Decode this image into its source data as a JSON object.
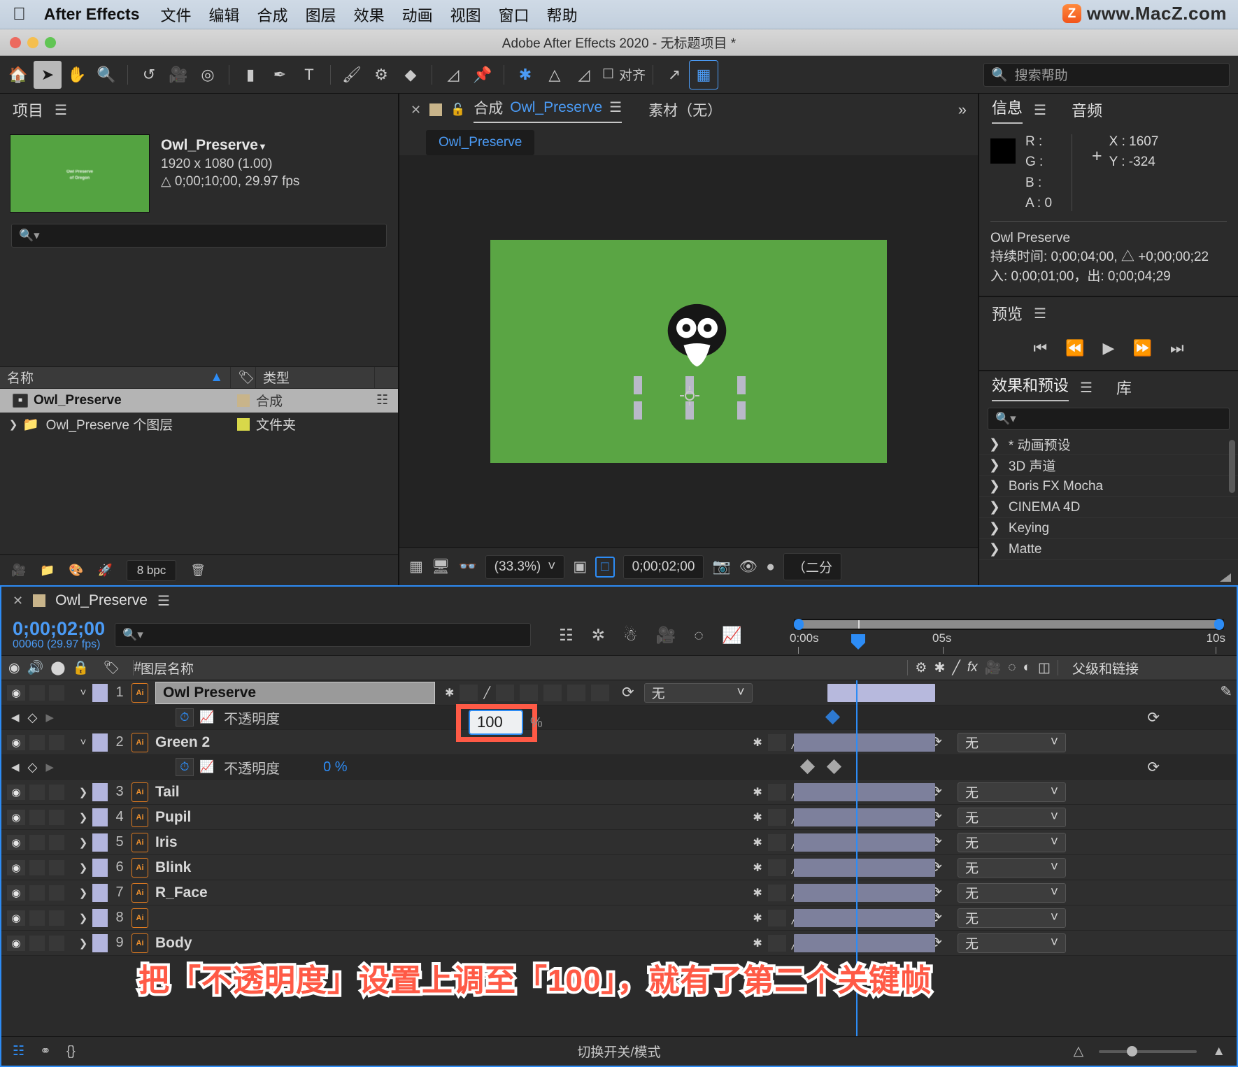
{
  "macmenu": {
    "apple": "apple-logo",
    "app": "After Effects",
    "items": [
      "文件",
      "编辑",
      "合成",
      "图层",
      "效果",
      "动画",
      "视图",
      "窗口",
      "帮助"
    ],
    "watermark_badge": "Z",
    "watermark_text": "www.MacZ.com"
  },
  "window": {
    "title": "Adobe After Effects 2020 - 无标题项目 *"
  },
  "toolbar": {
    "align_label": "对齐",
    "search_placeholder": "搜索帮助"
  },
  "project": {
    "tab": "项目",
    "item_name": "Owl_Preserve",
    "resolution": "1920 x 1080 (1.00)",
    "duration": "△ 0;00;10;00, 29.97 fps",
    "thumb_caption_line1": "Owl Preserve",
    "thumb_caption_line2": "of Oregon",
    "search_placeholder": "",
    "columns": [
      "名称",
      "类型"
    ],
    "rows": [
      {
        "name": "Owl_Preserve",
        "type": "合成",
        "selected": true
      },
      {
        "name": "Owl_Preserve 个图层",
        "type": "文件夹",
        "selected": false
      }
    ],
    "footer": {
      "bpc": "8 bpc"
    }
  },
  "comp": {
    "tab_prefix": "合成",
    "tab_name": "Owl_Preserve",
    "footage_tab": "素材（无）",
    "subtab": "Owl_Preserve",
    "toolbar": {
      "zoom": "(33.3%)",
      "time": "0;00;02;00",
      "view_mode": "（二分"
    }
  },
  "info": {
    "tabs": [
      "信息",
      "音频"
    ],
    "r_label": "R :",
    "g_label": "G :",
    "b_label": "B :",
    "a_label": "A :  0",
    "x_label": "X : 1607",
    "y_label": "Y :  -324",
    "layer_name": "Owl Preserve",
    "duration_line": "持续时间: 0;00;04;00, △ +0;00;00;22",
    "inout_line": "入: 0;00;01;00，出: 0;00;04;29"
  },
  "preview": {
    "tab": "预览"
  },
  "effects": {
    "tabs": [
      "效果和预设",
      "库"
    ],
    "items": [
      "* 动画预设",
      "3D 声道",
      "Boris FX Mocha",
      "CINEMA 4D",
      "Keying",
      "Matte"
    ]
  },
  "timeline": {
    "tab_name": "Owl_Preserve",
    "current_time": "0;00;02;00",
    "frame_info": "00060 (29.97 fps)",
    "columns": {
      "layer_name": "图层名称",
      "hash": "#",
      "parent_link": "父级和链接"
    },
    "ruler_labels": [
      "0:00s",
      "05s",
      "10s"
    ],
    "layers": [
      {
        "num": "1",
        "name": "Owl Preserve",
        "editing": true,
        "expanded": true,
        "parent": "无",
        "prop": {
          "name": "不透明度",
          "value": "100",
          "unit": "%",
          "editing": true
        }
      },
      {
        "num": "2",
        "name": "Green 2",
        "editing": false,
        "expanded": true,
        "parent": "无",
        "prop": {
          "name": "不透明度",
          "value": "0 %",
          "unit": "",
          "editing": false
        }
      },
      {
        "num": "3",
        "name": "Tail",
        "expanded": false,
        "parent": "无"
      },
      {
        "num": "4",
        "name": "Pupil",
        "expanded": false,
        "parent": "无"
      },
      {
        "num": "5",
        "name": "Iris",
        "expanded": false,
        "parent": "无"
      },
      {
        "num": "6",
        "name": "Blink",
        "expanded": false,
        "parent": "无"
      },
      {
        "num": "7",
        "name": "R_Face",
        "expanded": false,
        "parent": "无"
      },
      {
        "num": "8",
        "name": "",
        "expanded": false,
        "parent": "无"
      },
      {
        "num": "9",
        "name": "Body",
        "expanded": false,
        "parent": "无"
      }
    ],
    "footer": {
      "toggle_label": "切换开关/模式"
    }
  },
  "annotation": {
    "text": "把「不透明度」设置上调至「100」，就有了第二个关键帧"
  },
  "colors": {
    "accent_blue": "#2d8cf5",
    "annotation_red": "#ff5a46",
    "comp_green": "#5aa544",
    "layer_lavender": "#b3b5de",
    "ai_orange": "#f0922e"
  }
}
